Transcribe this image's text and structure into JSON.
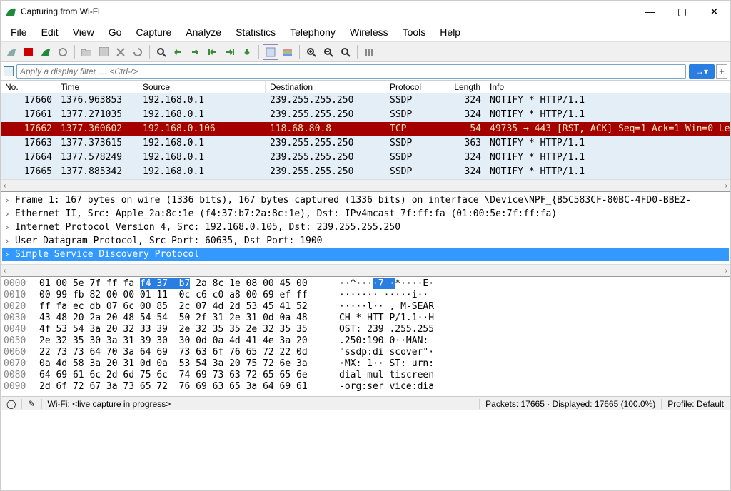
{
  "window": {
    "title": "Capturing from Wi-Fi"
  },
  "menu": [
    "File",
    "Edit",
    "View",
    "Go",
    "Capture",
    "Analyze",
    "Statistics",
    "Telephony",
    "Wireless",
    "Tools",
    "Help"
  ],
  "filter": {
    "placeholder": "Apply a display filter … <Ctrl-/>"
  },
  "columns": {
    "no": "No.",
    "time": "Time",
    "src": "Source",
    "dst": "Destination",
    "proto": "Protocol",
    "len": "Length",
    "info": "Info"
  },
  "rows": [
    {
      "no": "17660",
      "time": "1376.963853",
      "src": "192.168.0.1",
      "dst": "239.255.255.250",
      "proto": "SSDP",
      "len": "324",
      "info": "NOTIFY * HTTP/1.1",
      "red": false
    },
    {
      "no": "17661",
      "time": "1377.271035",
      "src": "192.168.0.1",
      "dst": "239.255.255.250",
      "proto": "SSDP",
      "len": "324",
      "info": "NOTIFY * HTTP/1.1",
      "red": false
    },
    {
      "no": "17662",
      "time": "1377.360602",
      "src": "192.168.0.106",
      "dst": "118.68.80.8",
      "proto": "TCP",
      "len": "54",
      "info": "49735 → 443 [RST, ACK] Seq=1 Ack=1 Win=0 Le",
      "red": true
    },
    {
      "no": "17663",
      "time": "1377.373615",
      "src": "192.168.0.1",
      "dst": "239.255.255.250",
      "proto": "SSDP",
      "len": "363",
      "info": "NOTIFY * HTTP/1.1",
      "red": false
    },
    {
      "no": "17664",
      "time": "1377.578249",
      "src": "192.168.0.1",
      "dst": "239.255.255.250",
      "proto": "SSDP",
      "len": "324",
      "info": "NOTIFY * HTTP/1.1",
      "red": false
    },
    {
      "no": "17665",
      "time": "1377.885342",
      "src": "192.168.0.1",
      "dst": "239.255.255.250",
      "proto": "SSDP",
      "len": "324",
      "info": "NOTIFY * HTTP/1.1",
      "red": false
    }
  ],
  "details": [
    "Frame 1: 167 bytes on wire (1336 bits), 167 bytes captured (1336 bits) on interface \\Device\\NPF_{B5C583CF-80BC-4FD0-BBE2-",
    "Ethernet II, Src: Apple_2a:8c:1e (f4:37:b7:2a:8c:1e), Dst: IPv4mcast_7f:ff:fa (01:00:5e:7f:ff:fa)",
    "Internet Protocol Version 4, Src: 192.168.0.105, Dst: 239.255.255.250",
    "User Datagram Protocol, Src Port: 60635, Dst Port: 1900",
    "Simple Service Discovery Protocol"
  ],
  "hex": [
    {
      "off": "0000",
      "h": "01 00 5e 7f ff fa ",
      "hl": "f4 37  b7",
      "h2": " 2a 8c 1e 08 00 45 00",
      "a": "··^···",
      "ahl": "·7 ·",
      "a2": "*····E·"
    },
    {
      "off": "0010",
      "h": "00 99 fb 82 00 00 01 11  0c c6 c0 a8 00 69 ef ff",
      "a": "······· ·····i··"
    },
    {
      "off": "0020",
      "h": "ff fa ec db 07 6c 00 85  2c 07 4d 2d 53 45 41 52",
      "a": "·····l·· , M-SEAR"
    },
    {
      "off": "0030",
      "h": "43 48 20 2a 20 48 54 54  50 2f 31 2e 31 0d 0a 48",
      "a": "CH * HTT P/1.1··H"
    },
    {
      "off": "0040",
      "h": "4f 53 54 3a 20 32 33 39  2e 32 35 35 2e 32 35 35",
      "a": "OST: 239 .255.255"
    },
    {
      "off": "0050",
      "h": "2e 32 35 30 3a 31 39 30  30 0d 0a 4d 41 4e 3a 20",
      "a": ".250:190 0··MAN: "
    },
    {
      "off": "0060",
      "h": "22 73 73 64 70 3a 64 69  73 63 6f 76 65 72 22 0d",
      "a": "\"ssdp:di scover\"·"
    },
    {
      "off": "0070",
      "h": "0a 4d 58 3a 20 31 0d 0a  53 54 3a 20 75 72 6e 3a",
      "a": "·MX: 1·· ST: urn:"
    },
    {
      "off": "0080",
      "h": "64 69 61 6c 2d 6d 75 6c  74 69 73 63 72 65 65 6e",
      "a": "dial-mul tiscreen"
    },
    {
      "off": "0090",
      "h": "2d 6f 72 67 3a 73 65 72  76 69 63 65 3a 64 69 61",
      "a": "-org:ser vice:dia"
    }
  ],
  "status": {
    "left": "Wi-Fi: <live capture in progress>",
    "packets": "Packets: 17665 · Displayed: 17665 (100.0%)",
    "profile": "Profile: Default"
  }
}
